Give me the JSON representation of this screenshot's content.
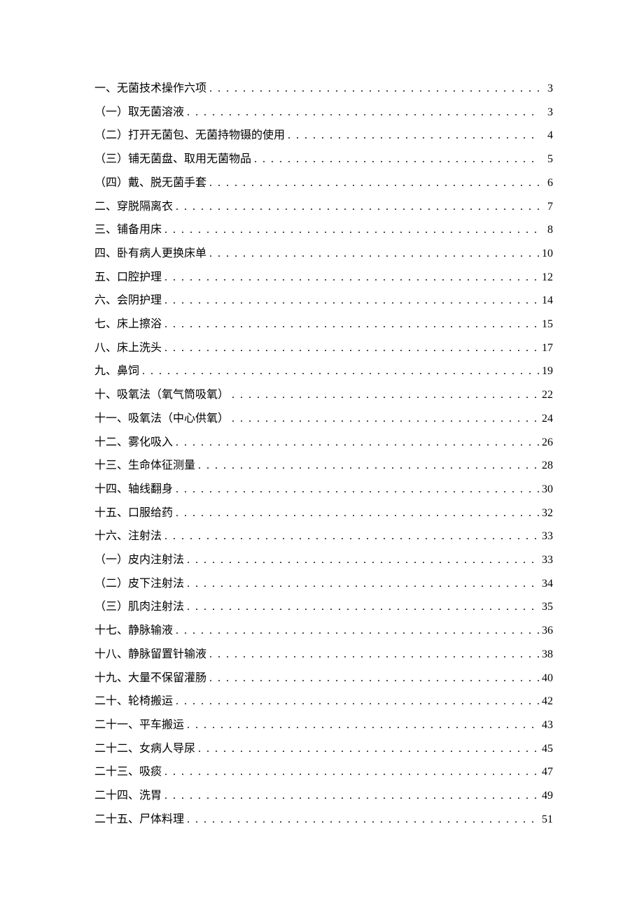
{
  "toc": [
    {
      "label": "一、无菌技术操作六项",
      "page": "3"
    },
    {
      "label": "（一）取无菌溶液",
      "page": "3"
    },
    {
      "label": "（二）打开无菌包、无菌持物镊的使用",
      "page": "4"
    },
    {
      "label": "（三）铺无菌盘、取用无菌物品",
      "page": "5"
    },
    {
      "label": "（四）戴、脱无菌手套",
      "page": "6"
    },
    {
      "label": "二、穿脱隔离衣",
      "page": "7"
    },
    {
      "label": "三、铺备用床",
      "page": "8"
    },
    {
      "label": "四、卧有病人更换床单",
      "page": "10"
    },
    {
      "label": "五、口腔护理",
      "page": "12"
    },
    {
      "label": "六、会阴护理",
      "page": "14"
    },
    {
      "label": "七、床上擦浴",
      "page": "15"
    },
    {
      "label": "八、床上洗头",
      "page": "17"
    },
    {
      "label": "九、鼻饲",
      "page": "19"
    },
    {
      "label": "十、吸氧法（氧气筒吸氧）",
      "page": "22"
    },
    {
      "label": "十一、吸氧法（中心供氧）",
      "page": "24"
    },
    {
      "label": "十二、雾化吸入",
      "page": "26"
    },
    {
      "label": "十三、生命体征测量",
      "page": "28"
    },
    {
      "label": "十四、轴线翻身",
      "page": "30"
    },
    {
      "label": "十五、口服给药",
      "page": "32"
    },
    {
      "label": "十六、注射法",
      "page": "33"
    },
    {
      "label": "（一）皮内注射法",
      "page": "33"
    },
    {
      "label": "（二）皮下注射法",
      "page": "34"
    },
    {
      "label": "（三）肌肉注射法",
      "page": "35"
    },
    {
      "label": "十七、静脉输液",
      "page": "36"
    },
    {
      "label": "十八、静脉留置针输液",
      "page": "38"
    },
    {
      "label": "十九、大量不保留灌肠",
      "page": "40"
    },
    {
      "label": "二十、轮椅搬运",
      "page": "42"
    },
    {
      "label": "二十一、平车搬运",
      "page": "43"
    },
    {
      "label": "二十二、女病人导尿",
      "page": "45"
    },
    {
      "label": "二十三、吸痰",
      "page": "47"
    },
    {
      "label": "二十四、洗胃",
      "page": "49"
    },
    {
      "label": "二十五、尸体料理",
      "page": "51"
    }
  ],
  "dots_fill": ". . . . . . . . . . . . . . . . . . . . . . . . . . . . . . . . . . . . . . . . . . . . . . . . . . . . . . . . . . . . . . . . . . . . . . . . . . . . . . . . . . . . . . . . . . . . . . . . . . . . . . . . . . . . . . . . . . . . . . . ."
}
